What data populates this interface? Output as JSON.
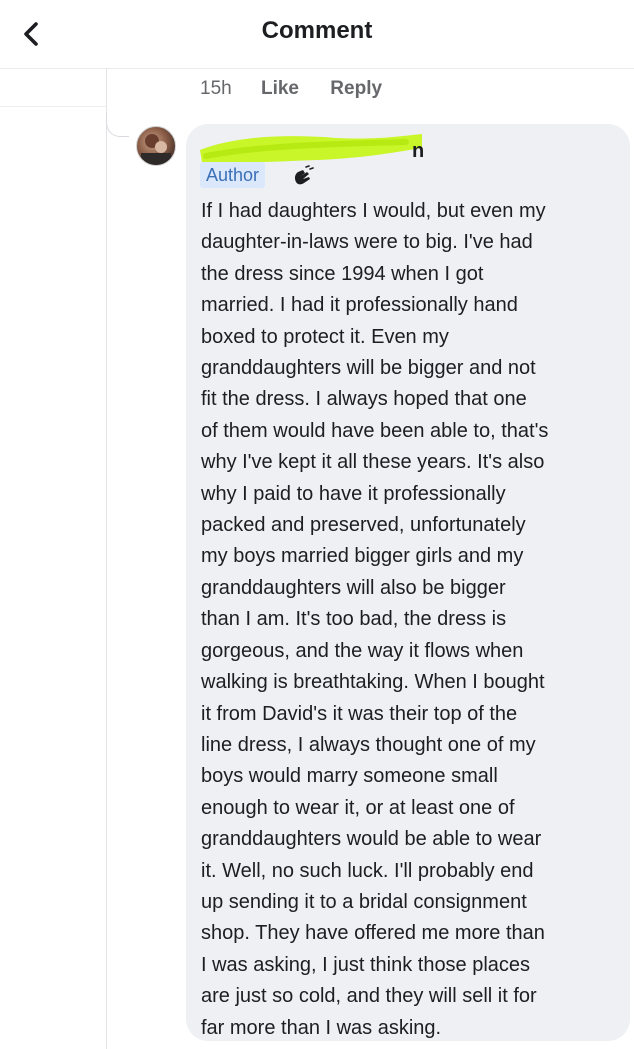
{
  "header": {
    "title": "Comment",
    "back_icon": "chevron-left-icon"
  },
  "previous_comment": {
    "time": "15h",
    "like_label": "Like",
    "reply_label": "Reply"
  },
  "reply": {
    "name_visible_fragment": "n",
    "badge": "Author",
    "badge_icon": "wave-icon",
    "lines": [
      "If I had daughters I would, but even my",
      "daughter-in-laws were to big.  I've had",
      "the dress since 1994 when I got",
      "married.  I had it professionally hand",
      "boxed to protect it.  Even my",
      "granddaughters will be bigger and not",
      "fit the dress.  I always hoped that one",
      "of them would have been able to, that's",
      "why I've kept it all these years.  It's also",
      "why I paid to have it professionally",
      "packed and preserved, unfortunately",
      "my boys married bigger girls and my",
      "granddaughters will also be bigger",
      "than I am.  It's too bad, the dress is",
      "gorgeous, and the way it flows when",
      "walking is breathtaking.  When I bought",
      "it from David's it was their top of the",
      "line dress, I always thought one of my",
      "boys would marry someone small",
      "enough to wear it, or at least one of",
      "granddaughters would be able to wear",
      "it.  Well, no such luck.  I'll probably end",
      "up sending it to a bridal consignment",
      "shop.  They have offered me more than",
      "I was asking, I just think those places",
      "are just so cold, and they will sell it for",
      "far more than I was asking."
    ]
  },
  "colors": {
    "bubble": "#eef0f4",
    "badge_bg": "#dbe7fb",
    "badge_text": "#3b6fb6",
    "redaction": "#c6f51c",
    "meta_text": "#65676b"
  }
}
